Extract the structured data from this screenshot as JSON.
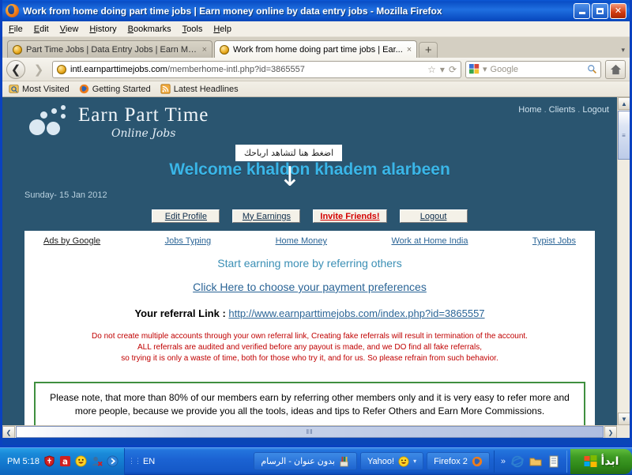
{
  "window": {
    "title": "Work from home doing part time jobs | Earn money online by data entry jobs - Mozilla Firefox",
    "minimize_label": "Minimize",
    "maximize_label": "Maximize",
    "close_label": "Close"
  },
  "menubar": [
    {
      "label": "File"
    },
    {
      "label": "Edit"
    },
    {
      "label": "View"
    },
    {
      "label": "History"
    },
    {
      "label": "Bookmarks"
    },
    {
      "label": "Tools"
    },
    {
      "label": "Help"
    }
  ],
  "tabs": [
    {
      "label": "Part Time Jobs | Data Entry Jobs | Earn Mo...",
      "close": "×",
      "active": false
    },
    {
      "label": "Work from home doing part time jobs | Ear...",
      "close": "×",
      "active": true
    }
  ],
  "newtab_label": "+",
  "tablist_chevron": "▾",
  "navbar": {
    "back_glyph": "❮",
    "forward_glyph": "❯",
    "url_host": "intl.earnparttimejobs.com",
    "url_path": "/memberhome-intl.php?id=3865557",
    "bookmark_star": "☆",
    "dropmarker": "▾",
    "reload_glyph": "⟳",
    "search_placeholder": "Google",
    "home_label": "Home"
  },
  "bookmarks": [
    {
      "label": "Most Visited",
      "icon": "most-visited-icon"
    },
    {
      "label": "Getting Started",
      "icon": "firefox-icon"
    },
    {
      "label": "Latest Headlines",
      "icon": "rss-icon"
    }
  ],
  "site": {
    "logo_title": "Earn Part Time",
    "logo_subtitle": "Online Jobs",
    "nav": [
      {
        "label": "Home"
      },
      {
        "label": "Clients"
      },
      {
        "label": "Logout"
      }
    ],
    "nav_separator": ".",
    "welcome": "Welcome khaldon khadem alarbeen",
    "tooltip": "اضغط هنا لتشاهد ارباحك",
    "tooltip_arrow": "↓",
    "date": "Sunday- 15 Jan 2012",
    "buttons": [
      {
        "label": "Edit Profile",
        "style": "normal"
      },
      {
        "label": "My Earnings",
        "style": "normal"
      },
      {
        "label": "Invite Friends!",
        "style": "alert"
      },
      {
        "label": "Logout",
        "style": "normal"
      }
    ],
    "ads": {
      "label": "Ads by Google",
      "links": [
        {
          "label": "Jobs Typing"
        },
        {
          "label": "Home Money"
        },
        {
          "label": "Work at Home India"
        },
        {
          "label": "Typist Jobs"
        }
      ]
    },
    "tagline": "Start earning more by referring others",
    "payment_preferences_link": "Click Here to choose your payment preferences",
    "referral_label": "Your referral Link : ",
    "referral_link": "http://www.earnparttimejobs.com/index.php?id=3865557",
    "warning_lines": [
      "Do not create multiple accounts through your own referral link, Creating fake referrals will result in termination of the account.",
      "ALL referrals are audited and verified before any payout is made, and we DO find all fake referrals,",
      "so trying it is only a waste of time, both for those who try it, and for us. So please refrain from such behavior."
    ],
    "note_box": "Please note, that more than 80% of our members earn by referring other members only and it is very easy to refer more and more people, because we provide you all the tools, ideas and tips to Refer Others and Earn More Commissions."
  },
  "scrollbars": {
    "up_glyph": "▲",
    "down_glyph": "▼",
    "left_glyph": "❮",
    "right_glyph": "❯",
    "v_grip": "≡",
    "h_grip": "‖‖"
  },
  "taskbar": {
    "start_label": "ابدأ",
    "quicklaunch_chevron": "«",
    "tasks": [
      {
        "label": "بدون عنوان - الرسام",
        "icon": "paint-icon"
      },
      {
        "label": "!Yahoo",
        "icon": "yahoo-icon",
        "dropmarker": "▾"
      },
      {
        "label": "Firefox 2",
        "icon": "firefox-icon"
      }
    ],
    "language": "EN",
    "language_grip": "⋮⋮",
    "clock": "PM 5:18"
  },
  "colors": {
    "site_bg": "#2a5570",
    "accent": "#3ab6e8",
    "link": "#2a6496",
    "warning": "#c00000",
    "note_border": "#3f8f3f",
    "alert": "#d40000",
    "titlebar": "#0a4ec6"
  }
}
